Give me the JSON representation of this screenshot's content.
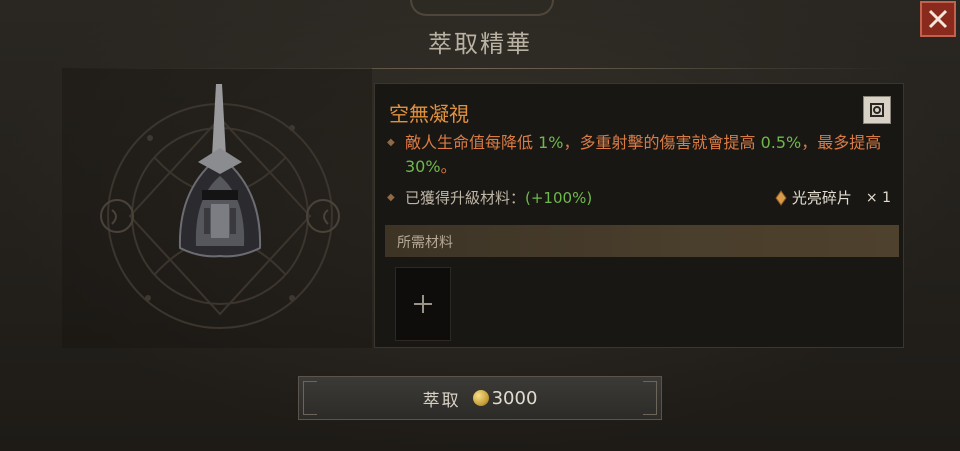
{
  "window": {
    "title": "萃取精華"
  },
  "close_icon": "close-icon",
  "aspect": {
    "name": "空無凝視",
    "desc_p1": "敵人生命值每降低 ",
    "desc_v1": "1%",
    "desc_p2": "，多重射擊的傷害就會提高 ",
    "desc_v2": "0.5%",
    "desc_p3": "，最多提高 ",
    "desc_v3": "30%",
    "desc_p4": "。"
  },
  "upgrade": {
    "label": "已獲得升級材料：",
    "value": "(+100%)",
    "material_name": "光亮碎片",
    "material_qty": "× 1"
  },
  "requirements": {
    "label": "所需材料"
  },
  "extract": {
    "label": "萃取",
    "cost": "3000"
  },
  "colors": {
    "accent_orange": "#e0913f",
    "green_value": "#6fb84b",
    "close_red": "#8a2a1d"
  }
}
